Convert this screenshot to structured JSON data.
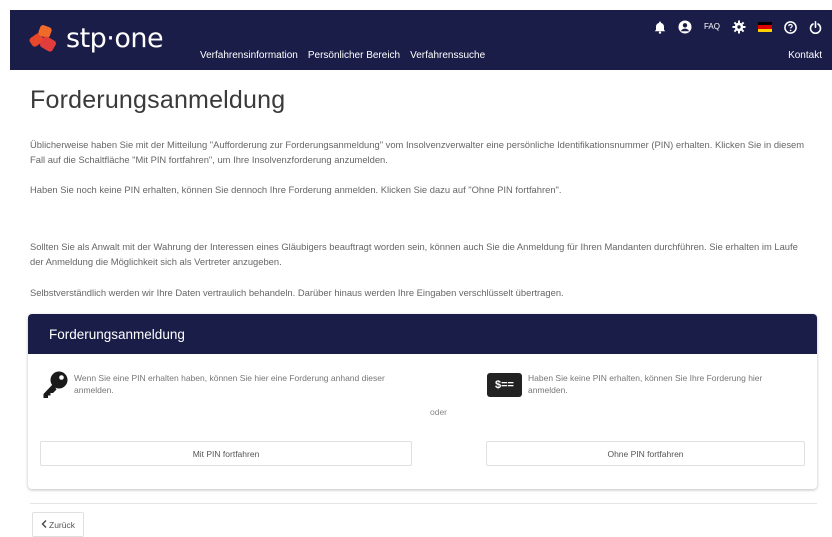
{
  "header": {
    "logo_text": "stp·one",
    "nav": [
      "Verfahrensinformation",
      "Persönlicher Bereich",
      "Verfahrenssuche"
    ],
    "faq_label": "FAQ",
    "kontakt_label": "Kontakt",
    "icons": [
      "bell-icon",
      "user-icon",
      "gear-icon",
      "german-flag-icon",
      "help-icon",
      "power-icon"
    ],
    "colors": {
      "bar": "#1b1d49",
      "logo_accent": "#e8472b"
    }
  },
  "page": {
    "title": "Forderungsanmeldung",
    "paragraphs": [
      "Üblicherweise haben Sie mit der Mitteilung \"Aufforderung zur Forderungsanmeldung\" vom Insolvenzverwalter eine persönliche Identifikationsnummer (PIN) erhalten. Klicken Sie in diesem Fall auf die Schaltfläche \"Mit PIN fortfahren\", um Ihre Insolvenzforderung anzumelden.",
      "Haben Sie noch keine PIN erhalten, können Sie dennoch Ihre Forderung anmelden. Klicken Sie dazu auf \"Ohne PIN fortfahren\".",
      "Sollten Sie als Anwalt mit der Wahrung der Interessen eines Gläubigers beauftragt worden sein, können auch Sie die Anmeldung für Ihren Mandanten durchführen. Sie erhalten im Laufe der Anmeldung die Möglichkeit sich als Vertreter anzugeben.",
      "Selbstverständlich werden wir Ihre Daten vertraulich behandeln. Darüber hinaus werden Ihre Eingaben verschlüsselt übertragen."
    ]
  },
  "card": {
    "title": "Forderungsanmeldung",
    "with_pin_text": "Wenn Sie eine PIN erhalten haben, können Sie hier eine Forderung anhand dieser anmelden.",
    "without_pin_text": "Haben Sie keine PIN erhalten, können Sie Ihre Forderung hier anmelden.",
    "or_label": "oder",
    "with_pin_button": "Mit PIN fortfahren",
    "without_pin_button": "Ohne PIN fortfahren",
    "dollar_icon_text": "$=="
  },
  "footer": {
    "back_label": "Zurück"
  }
}
